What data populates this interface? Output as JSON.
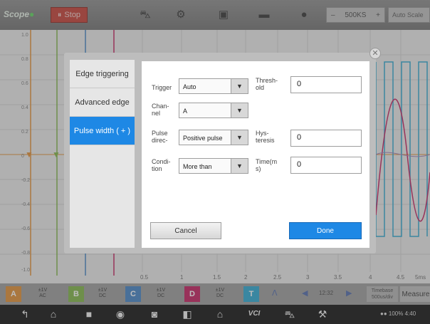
{
  "app": {
    "logo": "Scope",
    "stop_label": "Stop"
  },
  "toolbar": {
    "icons": [
      "car-icon",
      "gear-icon",
      "save-icon",
      "folder-icon",
      "help-icon"
    ],
    "sample_rate": {
      "minus": "–",
      "value": "500KS",
      "plus": "+"
    },
    "auto_label": "Auto Scale"
  },
  "scope": {
    "x_ticks": [
      "0.5",
      "1",
      "1.5",
      "2",
      "2.5",
      "3",
      "3.5",
      "4",
      "4.5",
      "5ms"
    ],
    "y_ticks": [
      "1.0",
      "0.8",
      "0.6",
      "0.4",
      "0.2",
      "0",
      "-0.2",
      "-0.4",
      "-0.6",
      "-0.8",
      "-1.0"
    ],
    "trace_colors": {
      "a": "#e08a2e",
      "b": "#7cb342",
      "c": "#3f7fc4",
      "d": "#c2185b",
      "e": "#26a6d1"
    }
  },
  "channel_bar": {
    "channels": [
      {
        "letter": "A",
        "color": "#e08a2e",
        "range": "±1V",
        "coupling": "AC"
      },
      {
        "letter": "B",
        "color": "#7cb342",
        "range": "±1V",
        "coupling": "DC"
      },
      {
        "letter": "C",
        "color": "#3f7fc4",
        "range": "±1V",
        "coupling": "DC"
      },
      {
        "letter": "D",
        "color": "#c2185b",
        "range": "±1V",
        "coupling": "DC"
      }
    ],
    "t_label": "T",
    "cursor_time": "12:32",
    "timebase": {
      "title": "Timebase",
      "value": "500us/div"
    },
    "measure_label": "Measure"
  },
  "dialog": {
    "tabs": [
      "Edge triggering",
      "Advanced edge",
      "Pulse width ( + )"
    ],
    "active_tab": 2,
    "trigger": {
      "label": "Trigger",
      "value": "Auto"
    },
    "channel": {
      "label": "Chan-\nnel",
      "value": "A"
    },
    "pulse_direction": {
      "label": "Pulse\ndirec-",
      "value": "Positive pulse"
    },
    "condition": {
      "label": "Condi-\ntion",
      "value": "More than"
    },
    "threshold": {
      "label": "Thresh-\nold",
      "value": "0"
    },
    "hysteresis": {
      "label": "Hys-\nteresis",
      "value": "0"
    },
    "time": {
      "label": "Time(m\ns)",
      "value": "0"
    },
    "cancel_label": "Cancel",
    "done_label": "Done"
  },
  "navbar": {
    "icons": [
      "back-icon",
      "home-icon",
      "recent-apps-icon",
      "browser-icon",
      "camera-icon",
      "split-screen-icon",
      "garage-icon",
      "vci-icon",
      "car-icon",
      "workshop-icon"
    ],
    "vci_label": "VCI",
    "status": "100% 4:40"
  }
}
